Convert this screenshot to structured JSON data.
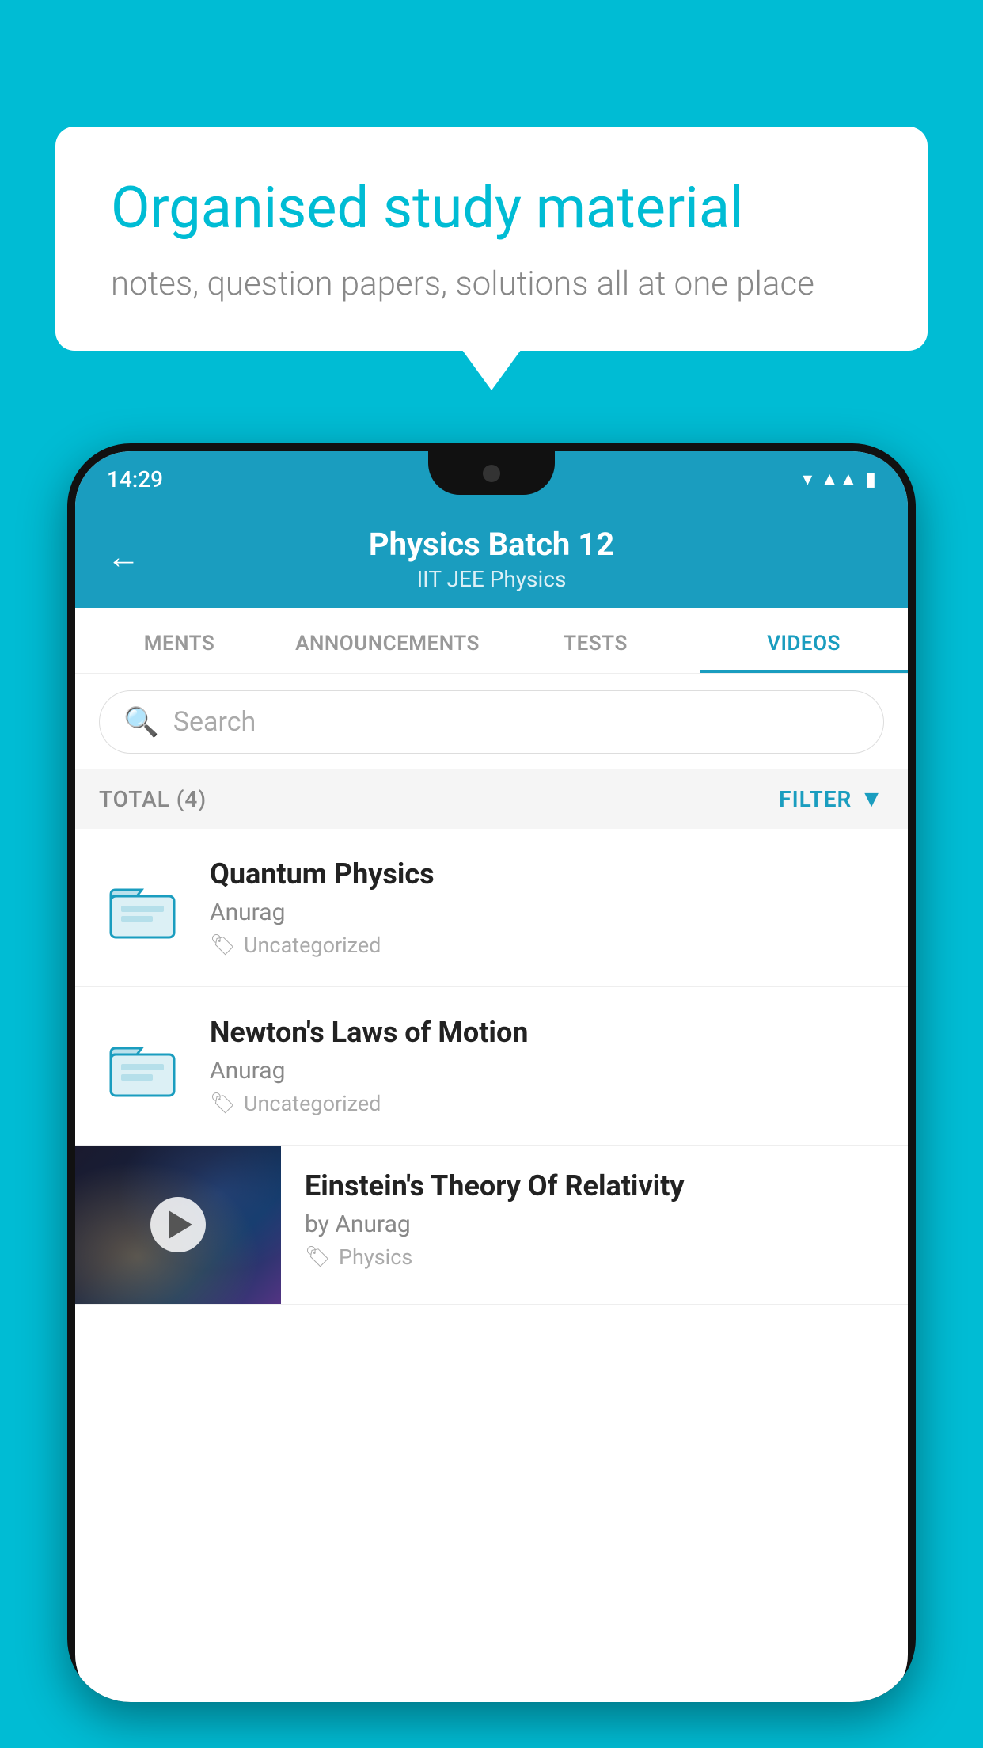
{
  "background": {
    "color": "#00BCD4"
  },
  "speech_bubble": {
    "title": "Organised study material",
    "subtitle": "notes, question papers, solutions all at one place"
  },
  "phone": {
    "status_bar": {
      "time": "14:29"
    },
    "header": {
      "back_label": "←",
      "title": "Physics Batch 12",
      "subtitle": "IIT JEE   Physics"
    },
    "tabs": [
      {
        "label": "MENTS",
        "active": false
      },
      {
        "label": "ANNOUNCEMENTS",
        "active": false
      },
      {
        "label": "TESTS",
        "active": false
      },
      {
        "label": "VIDEOS",
        "active": true
      }
    ],
    "search": {
      "placeholder": "Search"
    },
    "filter_bar": {
      "total_label": "TOTAL (4)",
      "filter_label": "FILTER"
    },
    "videos": [
      {
        "title": "Quantum Physics",
        "author": "Anurag",
        "tag": "Uncategorized",
        "has_thumbnail": false
      },
      {
        "title": "Newton's Laws of Motion",
        "author": "Anurag",
        "tag": "Uncategorized",
        "has_thumbnail": false
      },
      {
        "title": "Einstein's Theory Of Relativity",
        "author": "by Anurag",
        "tag": "Physics",
        "has_thumbnail": true
      }
    ]
  }
}
